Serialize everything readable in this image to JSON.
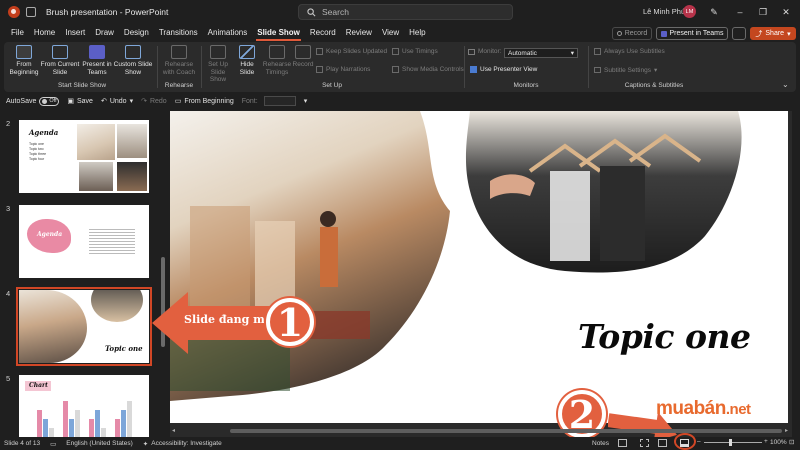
{
  "app": {
    "document_title": "Brush presentation",
    "app_name": "PowerPoint",
    "title_separator": " - ",
    "search_placeholder": "Search",
    "user_name": "Lê Minh Phú",
    "user_initials": "LM"
  },
  "tabs": [
    "File",
    "Home",
    "Insert",
    "Draw",
    "Design",
    "Transitions",
    "Animations",
    "Slide Show",
    "Record",
    "Review",
    "View",
    "Help"
  ],
  "active_tab": "Slide Show",
  "header_buttons": {
    "record": "Record",
    "present_in_teams": "Present in Teams",
    "share": "Share"
  },
  "ribbon": {
    "start_slide_show": {
      "label": "Start Slide Show",
      "from_beginning": "From Beginning",
      "from_current": "From Current Slide",
      "present_in_teams": "Present in Teams",
      "custom_slide_show": "Custom Slide Show"
    },
    "rehearse": {
      "label": "Rehearse",
      "rehearse_with_coach": "Rehearse with Coach"
    },
    "set_up": {
      "label": "Set Up",
      "set_up_slide_show": "Set Up Slide Show",
      "hide_slide": "Hide Slide",
      "rehearse_timings": "Rehearse Timings",
      "record": "Record",
      "keep_slides_updated": "Keep Slides Updated",
      "play_narrations": "Play Narrations",
      "use_timings": "Use Timings",
      "show_media_controls": "Show Media Controls"
    },
    "monitors": {
      "label": "Monitors",
      "monitor_label": "Monitor:",
      "monitor_value": "Automatic",
      "use_presenter_view": "Use Presenter View"
    },
    "captions": {
      "label": "Captions & Subtitles",
      "always_use_subtitles": "Always Use Subtitles",
      "subtitle_settings": "Subtitle Settings"
    }
  },
  "quick_access": {
    "autosave": "AutoSave",
    "autosave_state": "Off",
    "save": "Save",
    "undo": "Undo",
    "redo": "Redo",
    "from_beginning": "From Beginning",
    "font": "Font:"
  },
  "thumbnails": [
    {
      "number": "2",
      "title": "Agenda",
      "lines": [
        "Topic one",
        "Topic two",
        "Topic three",
        "Topic four"
      ],
      "selected": false
    },
    {
      "number": "3",
      "title": "Agenda",
      "selected": false
    },
    {
      "number": "4",
      "title": "Topic one",
      "selected": true
    },
    {
      "number": "5",
      "title": "Chart",
      "selected": false
    }
  ],
  "chart_thumb": {
    "series_colors": [
      "#e58aa8",
      "#7da6d9",
      "#d9d9d9"
    ],
    "values": [
      [
        3,
        2,
        1
      ],
      [
        4,
        2,
        3
      ],
      [
        2,
        3,
        1
      ],
      [
        2,
        3,
        4
      ]
    ]
  },
  "slide": {
    "title": "Topic one"
  },
  "annotations": {
    "callout_text": "Slide đang mở",
    "badge_1": "1",
    "badge_2": "2",
    "watermark": "muabán",
    "watermark_tld": ".net"
  },
  "status": {
    "slide_info": "Slide 4 of 13",
    "language": "English (United States)",
    "accessibility": "Accessibility: Investigate",
    "notes": "Notes",
    "zoom": "100%"
  },
  "colors": {
    "accent": "#d24726",
    "share": "#c4471f",
    "annotation": "#e2603f"
  }
}
